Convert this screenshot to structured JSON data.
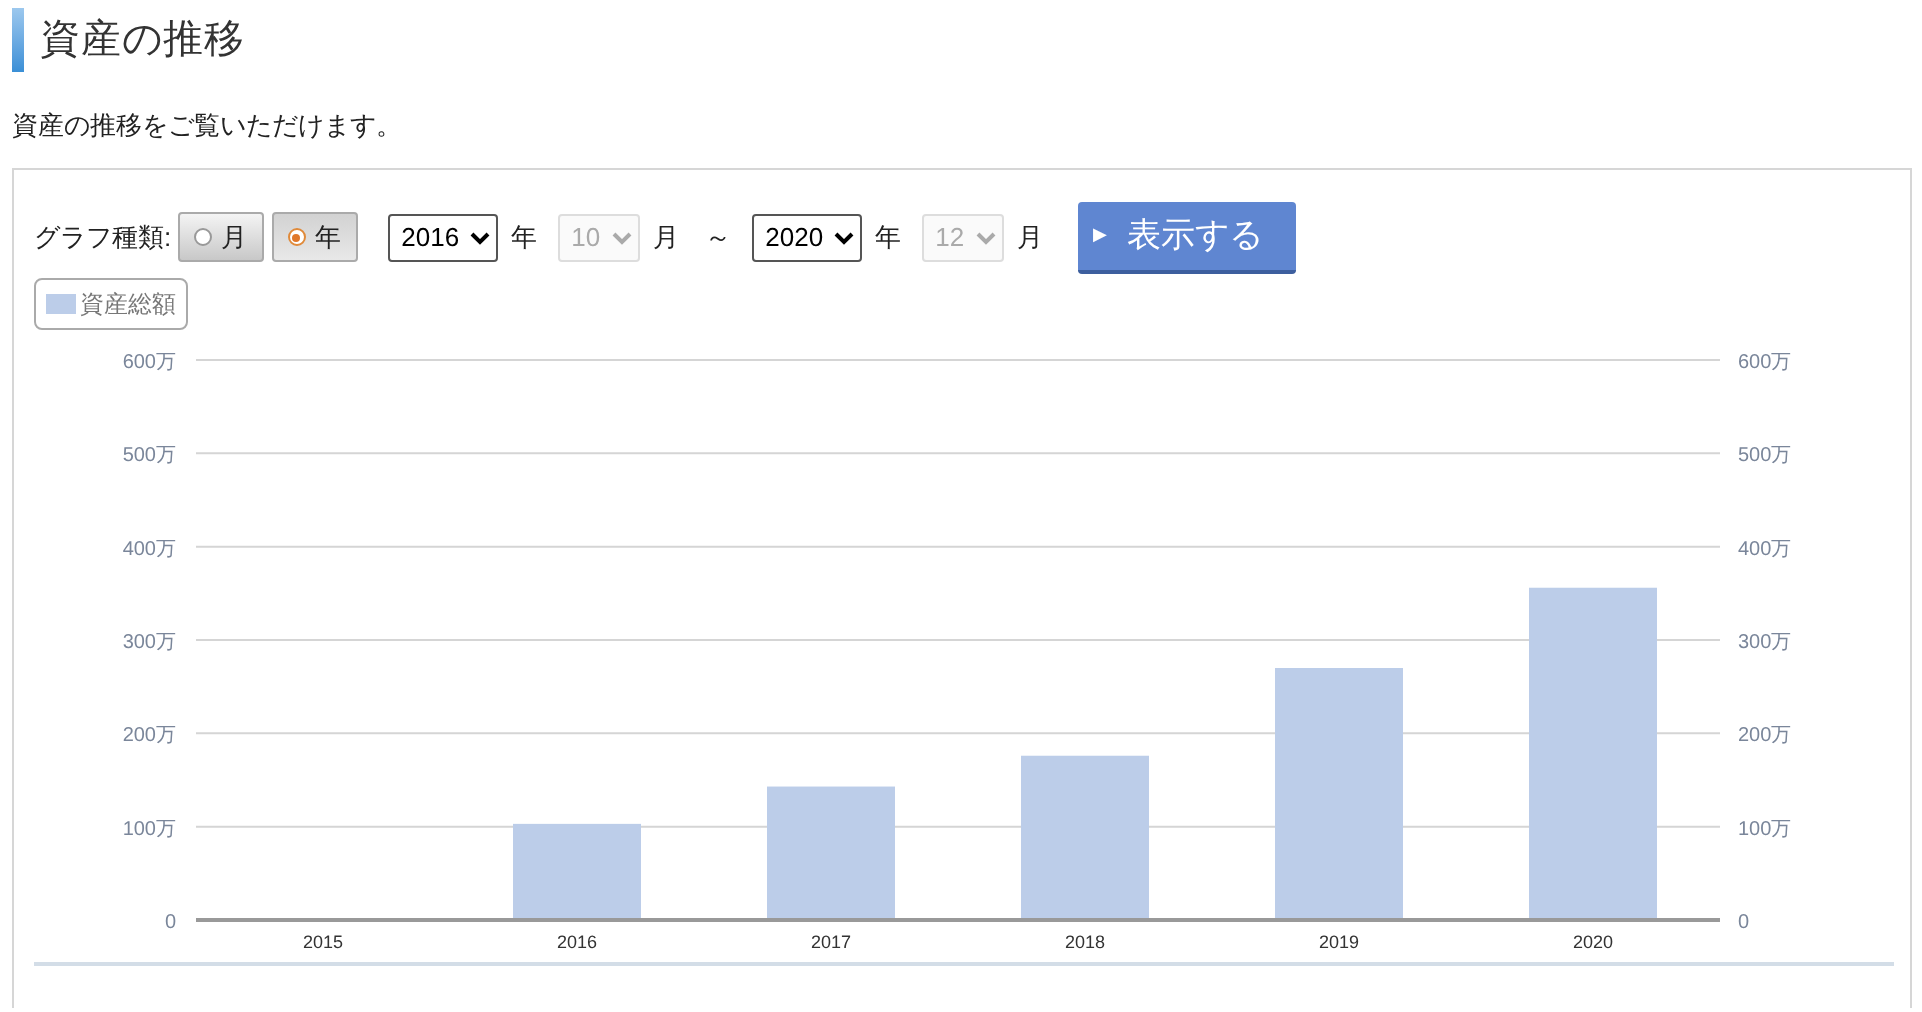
{
  "heading": "資産の推移",
  "description": "資産の推移をご覧いただけます。",
  "controls": {
    "label": "グラフ種類:",
    "graph_types": [
      {
        "label": "月",
        "selected": false
      },
      {
        "label": "年",
        "selected": true
      }
    ],
    "range": [
      {
        "kind": "select",
        "value": "2016",
        "disabled": false
      },
      {
        "kind": "unit",
        "label": "年"
      },
      {
        "kind": "select",
        "value": "10",
        "disabled": true
      },
      {
        "kind": "unit",
        "label": "月"
      },
      {
        "kind": "separator",
        "label": "～"
      },
      {
        "kind": "select",
        "value": "2020",
        "disabled": false
      },
      {
        "kind": "unit",
        "label": "年"
      },
      {
        "kind": "select",
        "value": "12",
        "disabled": true
      },
      {
        "kind": "unit",
        "label": "月"
      }
    ],
    "submit": {
      "icon": "▶",
      "label": "表示する"
    }
  },
  "right_axis_labels": [
    "600万",
    "500万",
    "400万",
    "300万",
    "200万",
    "100万",
    "0"
  ],
  "chart_data": {
    "type": "bar",
    "categories": [
      "2015",
      "2016",
      "2017",
      "2018",
      "2019",
      "2020"
    ],
    "series": [
      {
        "name": "資産総額",
        "color": "#bccde9",
        "values": [
          null,
          103,
          143,
          176,
          270,
          356
        ]
      }
    ],
    "ylim": [
      0,
      600
    ],
    "grid": true,
    "yticks": [
      {
        "value": 0,
        "label": "0"
      },
      {
        "value": 100,
        "label": "100万"
      },
      {
        "value": 200,
        "label": "200万"
      },
      {
        "value": 300,
        "label": "300万"
      },
      {
        "value": 400,
        "label": "400万"
      },
      {
        "value": 500,
        "label": "500万"
      },
      {
        "value": 600,
        "label": "600万"
      }
    ]
  }
}
